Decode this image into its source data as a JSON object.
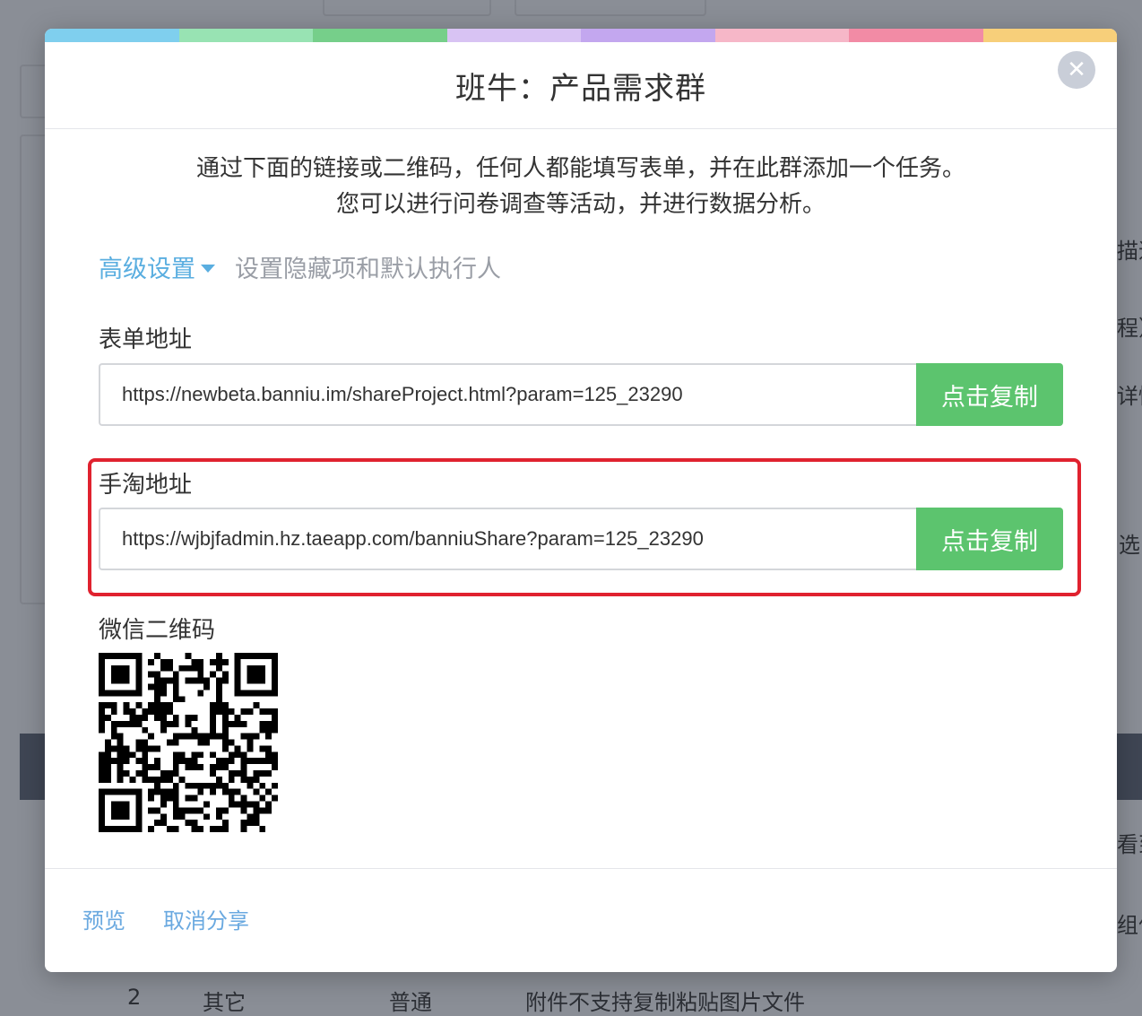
{
  "colors": {
    "stripe": [
      "#7fcfee",
      "#98e3b3",
      "#76cf8a",
      "#d8c3f3",
      "#c3a7ef",
      "#f6b7c8",
      "#f28ba5",
      "#f7cf7a"
    ],
    "accent_link": "#5aaee0",
    "copy_button": "#5cc46e",
    "highlight_border": "#e0222f"
  },
  "modal": {
    "title": "班牛：产品需求群",
    "close_icon": "close-icon",
    "intro_line1": "通过下面的链接或二维码，任何人都能填写表单，并在此群添加一个任务。",
    "intro_line2": "您可以进行问卷调查等活动，并进行数据分析。",
    "advanced_settings": "高级设置",
    "advanced_hint": "设置隐藏项和默认执行人",
    "form_address": {
      "label": "表单地址",
      "url": "https://newbeta.banniu.im/shareProject.html?param=125_23290",
      "copy_label": "点击复制"
    },
    "mobile_taobao_address": {
      "label": "手淘地址",
      "url": "https://wjbjfadmin.hz.taeapp.com/banniuShare?param=125_23290",
      "copy_label": "点击复制"
    },
    "wechat_qr": {
      "label": "微信二维码"
    },
    "footer": {
      "preview": "预览",
      "cancel_share": "取消分享"
    }
  },
  "background": {
    "right_fragments": [
      "描述",
      "程）",
      "详情",
      "选",
      "看到",
      "组件"
    ],
    "bottom_row": [
      "2",
      "其它",
      "普通",
      "附件不支持复制粘贴图片文件"
    ]
  }
}
